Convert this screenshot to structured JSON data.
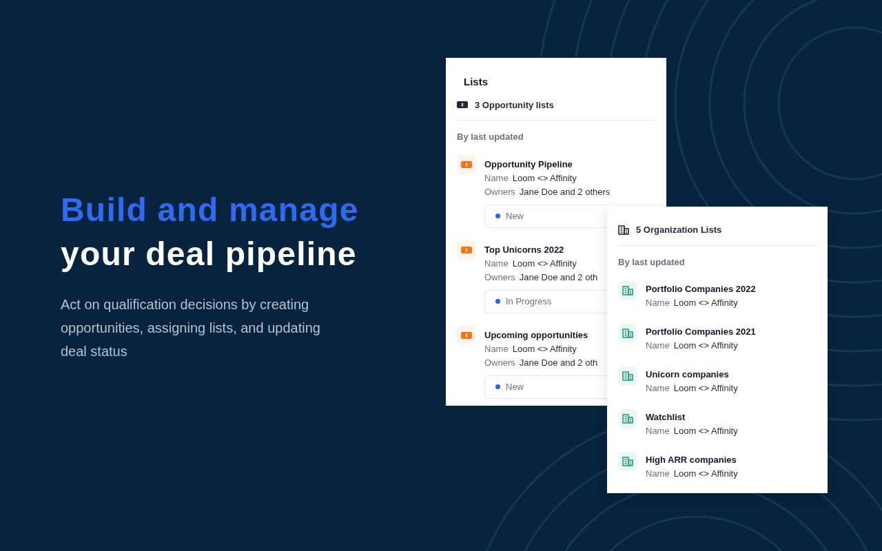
{
  "hero": {
    "title_highlight": "Build and manage",
    "title_rest": "your deal pipeline",
    "body": "Act on qualification decisions by creating opportunities, assigning lists, and updating deal status"
  },
  "opportunity_card": {
    "title": "Lists",
    "count_label": "3 Opportunity lists",
    "sort_label": "By last updated",
    "items": [
      {
        "title": "Opportunity Pipeline",
        "name_label": "Name",
        "name": "Loom <> Affinity",
        "owners_label": "Owners",
        "owners": "Jane Doe and 2 others",
        "status": "New",
        "color": "#2563eb"
      },
      {
        "title": "Top Unicorns 2022",
        "name_label": "Name",
        "name": "Loom <> Affinity",
        "owners_label": "Owners",
        "owners": "Jane Doe and 2 oth",
        "status": "In Progress",
        "color": "#2563eb"
      },
      {
        "title": "Upcoming opportunities",
        "name_label": "Name",
        "name": "Loom <> Affinity",
        "owners_label": "Owners",
        "owners": "Jane Doe and 2 oth",
        "status": "New",
        "color": "#2563eb"
      }
    ]
  },
  "organization_card": {
    "count_label": "5 Organization Lists",
    "sort_label": "By last updated",
    "items": [
      {
        "title": "Portfolio Companies 2022",
        "name_label": "Name",
        "name": "Loom <> Affinity"
      },
      {
        "title": "Portfolio Companies 2021",
        "name_label": "Name",
        "name": "Loom <> Affinity"
      },
      {
        "title": "Unicorn companies",
        "name_label": "Name",
        "name": "Loom <> Affinity"
      },
      {
        "title": "Watchlist",
        "name_label": "Name",
        "name": "Loom <> Affinity"
      },
      {
        "title": "High ARR companies",
        "name_label": "Name",
        "name": "Loom <> Affinity"
      }
    ]
  }
}
